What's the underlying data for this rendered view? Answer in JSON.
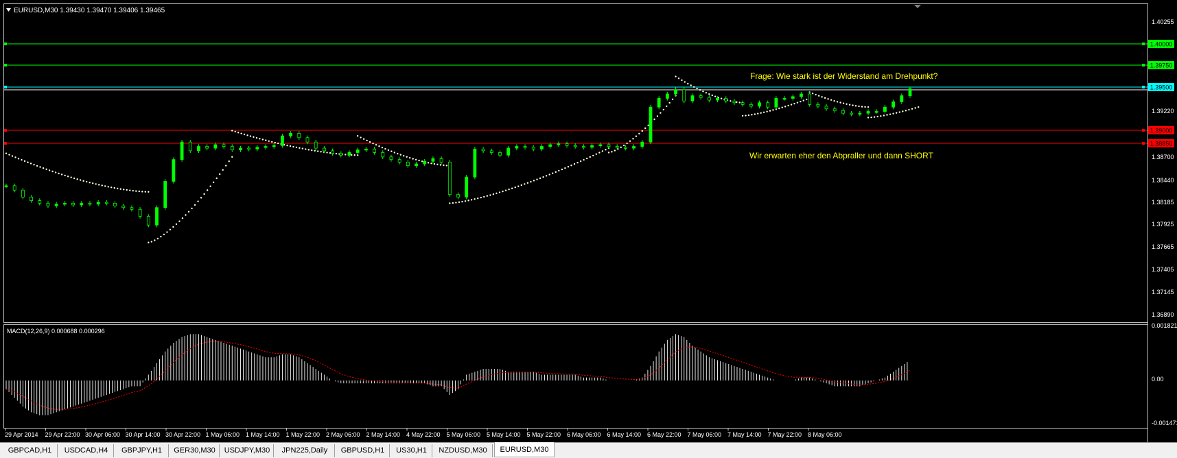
{
  "window": {
    "symbol_info": "EURUSD,M30  1.39430 1.39470 1.39406 1.39465"
  },
  "colors": {
    "background": "#000000",
    "frame": "#c0c0c0",
    "candle": "#00ff00",
    "psar": "#ffffe0",
    "level_green": "#00ff00",
    "level_cyan": "#00ffff",
    "level_red": "#ff0000",
    "annotation": "#ffff00",
    "macd_hist": "#ffffff",
    "macd_signal": "#ff0000"
  },
  "price_axis": {
    "labels": [
      "1.40255",
      "1.39220",
      "1.38700",
      "1.38440",
      "1.38185",
      "1.37925",
      "1.37665",
      "1.37405",
      "1.37145",
      "1.36890"
    ]
  },
  "level_labels": [
    {
      "text": "1.40000",
      "kind": "green"
    },
    {
      "text": "1.39750",
      "kind": "green"
    },
    {
      "text": "1.39500",
      "kind": "cyan"
    },
    {
      "text": "1.39000",
      "kind": "red"
    },
    {
      "text": "1.38850",
      "kind": "red"
    }
  ],
  "annotations": {
    "question": "Frage: Wie stark ist der Widerstand am Drehpunkt?",
    "expectation": "Wir erwarten eher den Abpraller und dann SHORT"
  },
  "macd": {
    "title": "MACD(12,26,9) 0.000688 0.000296",
    "axis_labels": [
      "0.001821",
      "0.00",
      "-0.001471"
    ]
  },
  "time_axis": {
    "labels": [
      "29 Apr 2014",
      "29 Apr 22:00",
      "30 Apr 06:00",
      "30 Apr 14:00",
      "30 Apr 22:00",
      "1 May 06:00",
      "1 May 14:00",
      "1 May 22:00",
      "2 May 06:00",
      "2 May 14:00",
      "4 May 22:00",
      "5 May 06:00",
      "5 May 14:00",
      "5 May 22:00",
      "6 May 06:00",
      "6 May 14:00",
      "6 May 22:00",
      "7 May 06:00",
      "7 May 14:00",
      "7 May 22:00",
      "8 May 06:00"
    ]
  },
  "tabs": [
    {
      "label": "GBPCAD,H1",
      "active": false
    },
    {
      "label": "USDCAD,H4",
      "active": false
    },
    {
      "label": "GBPJPY,H1",
      "active": false
    },
    {
      "label": "GER30,M30",
      "active": false
    },
    {
      "label": "USDJPY,M30",
      "active": false
    },
    {
      "label": "JPN225,Daily",
      "active": false
    },
    {
      "label": "GBPUSD,H1",
      "active": false
    },
    {
      "label": "US30,H1",
      "active": false
    },
    {
      "label": "NZDUSD,M30",
      "active": false
    },
    {
      "label": "EURUSD,M30",
      "active": true
    }
  ],
  "chart_data": {
    "type": "line",
    "price_range": [
      1.3689,
      1.4035
    ],
    "closes": [
      1.3835,
      1.383,
      1.3822,
      1.3818,
      1.3815,
      1.3812,
      1.3814,
      1.3815,
      1.3813,
      1.3815,
      1.3814,
      1.3816,
      1.3815,
      1.3812,
      1.381,
      1.3808,
      1.38,
      1.379,
      1.381,
      1.384,
      1.3865,
      1.3885,
      1.3875,
      1.388,
      1.3878,
      1.3882,
      1.388,
      1.3876,
      1.3878,
      1.3877,
      1.3879,
      1.388,
      1.3881,
      1.3892,
      1.3895,
      1.389,
      1.3885,
      1.3878,
      1.3875,
      1.3872,
      1.387,
      1.3873,
      1.3876,
      1.3877,
      1.3873,
      1.3868,
      1.3865,
      1.3862,
      1.3858,
      1.386,
      1.3863,
      1.3866,
      1.3862,
      1.3825,
      1.3822,
      1.3845,
      1.3877,
      1.3875,
      1.3873,
      1.387,
      1.3878,
      1.388,
      1.3879,
      1.3877,
      1.388,
      1.3882,
      1.3883,
      1.3881,
      1.388,
      1.3879,
      1.3881,
      1.3882,
      1.388,
      1.3879,
      1.3878,
      1.388,
      1.3885,
      1.3925,
      1.3935,
      1.394,
      1.3945,
      1.3932,
      1.3938,
      1.3936,
      1.3933,
      1.3935,
      1.3932,
      1.393,
      1.3928,
      1.3926,
      1.393,
      1.3925,
      1.3935,
      1.3935,
      1.3937,
      1.394,
      1.3928,
      1.3926,
      1.3923,
      1.3921,
      1.3918,
      1.3917,
      1.3918,
      1.392,
      1.392,
      1.3925,
      1.3931,
      1.3938,
      1.3946
    ],
    "psar_segments": [
      {
        "from": 0,
        "to": 17,
        "start": 1.3872,
        "end": 1.3828,
        "side": "above"
      },
      {
        "from": 17,
        "to": 27,
        "start": 1.377,
        "end": 1.3868,
        "side": "below"
      },
      {
        "from": 27,
        "to": 42,
        "start": 1.3898,
        "end": 1.387,
        "side": "above"
      },
      {
        "from": 42,
        "to": 53,
        "start": 1.3892,
        "end": 1.3858,
        "side": "above"
      },
      {
        "from": 53,
        "to": 72,
        "start": 1.3815,
        "end": 1.3878,
        "side": "below"
      },
      {
        "from": 72,
        "to": 80,
        "start": 1.3873,
        "end": 1.3938,
        "side": "below"
      },
      {
        "from": 80,
        "to": 88,
        "start": 1.396,
        "end": 1.393,
        "side": "above"
      },
      {
        "from": 88,
        "to": 96,
        "start": 1.3915,
        "end": 1.3935,
        "side": "below"
      },
      {
        "from": 96,
        "to": 103,
        "start": 1.3942,
        "end": 1.3925,
        "side": "above"
      },
      {
        "from": 103,
        "to": 109,
        "start": 1.3913,
        "end": 1.3925,
        "side": "below"
      }
    ],
    "macd_hist": [
      -0.0003,
      -0.0006,
      -0.0009,
      -0.0011,
      -0.0012,
      -0.0012,
      -0.0011,
      -0.001,
      -0.0009,
      -0.0008,
      -0.0007,
      -0.0006,
      -0.0005,
      -0.0004,
      -0.0003,
      -0.0002,
      -0.0002,
      0.0002,
      0.0006,
      0.001,
      0.0013,
      0.0015,
      0.0016,
      0.0016,
      0.0015,
      0.0014,
      0.0013,
      0.0012,
      0.0011,
      0.001,
      0.0009,
      0.0008,
      0.0008,
      0.0009,
      0.0009,
      0.0008,
      0.0006,
      0.0004,
      0.0002,
      0.0,
      -0.0001,
      -0.0001,
      -0.0001,
      -0.0001,
      -0.0001,
      -0.0001,
      -0.0001,
      -0.0001,
      -0.0001,
      -0.0001,
      -0.0001,
      -0.0002,
      -0.0002,
      -0.0005,
      -0.0003,
      0.0002,
      0.0003,
      0.0004,
      0.0004,
      0.0004,
      0.0003,
      0.0003,
      0.0003,
      0.0003,
      0.0002,
      0.0002,
      0.0002,
      0.0002,
      0.0002,
      0.0001,
      0.0001,
      0.0001,
      0.0,
      0.0,
      0.0,
      0.0,
      0.0001,
      0.0005,
      0.001,
      0.0014,
      0.0016,
      0.0015,
      0.0012,
      0.001,
      0.0008,
      0.0007,
      0.0006,
      0.0005,
      0.0004,
      0.0003,
      0.0002,
      0.0001,
      0.0,
      0.0,
      0.0,
      0.0001,
      0.0001,
      0.0,
      -0.0001,
      -0.0002,
      -0.0002,
      -0.0002,
      -0.0002,
      -0.0001,
      0.0,
      0.0001,
      0.0003,
      0.0005,
      0.0007
    ],
    "macd_range": [
      -0.001471,
      0.001821
    ]
  }
}
